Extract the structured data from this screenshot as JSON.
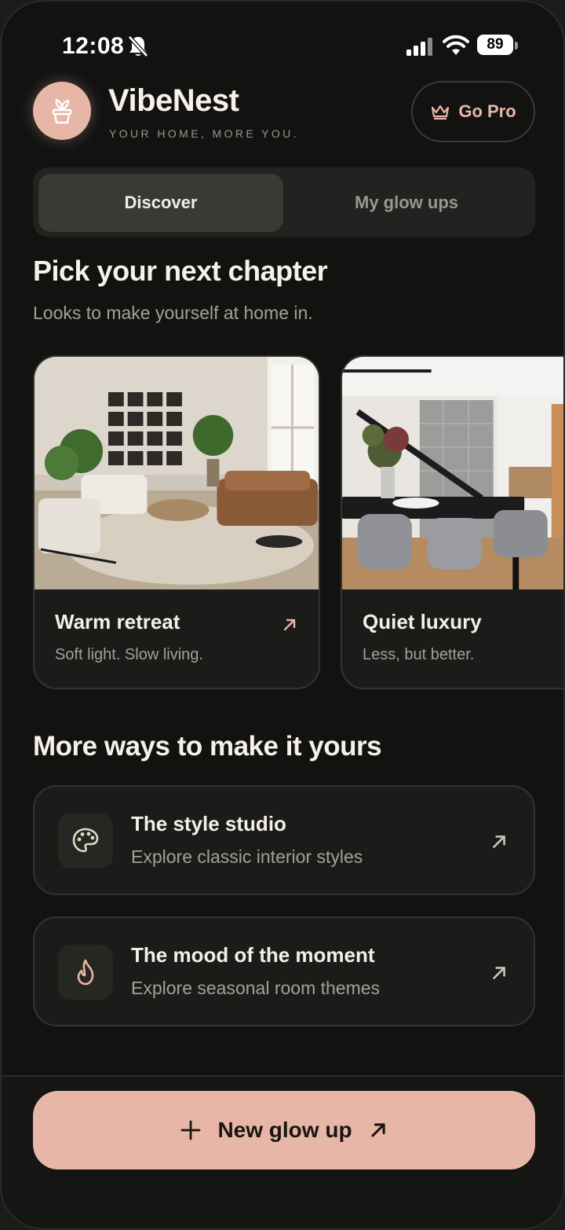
{
  "status_bar": {
    "time": "12:08",
    "battery": "89"
  },
  "header": {
    "app_name": "VibeNest",
    "tagline": "YOUR HOME, MORE YOU.",
    "go_pro_label": "Go Pro"
  },
  "tabs": [
    {
      "label": "Discover",
      "active": true
    },
    {
      "label": "My glow ups",
      "active": false
    }
  ],
  "chapter": {
    "title": "Pick your next chapter",
    "subtitle": "Looks to make yourself at home in."
  },
  "style_cards": [
    {
      "title": "Warm retreat",
      "subtitle": "Soft light. Slow living."
    },
    {
      "title": "Quiet luxury",
      "subtitle": "Less, but better."
    }
  ],
  "more": {
    "title": "More ways to make it yours",
    "items": [
      {
        "title": "The style studio",
        "subtitle": "Explore classic interior styles",
        "icon": "palette-icon"
      },
      {
        "title": "The mood of the moment",
        "subtitle": "Explore seasonal room themes",
        "icon": "flame-icon"
      }
    ]
  },
  "cta": {
    "label": "New glow up"
  },
  "colors": {
    "accent": "#e8b6a6",
    "background": "#121211",
    "card": "#1b1b19"
  }
}
